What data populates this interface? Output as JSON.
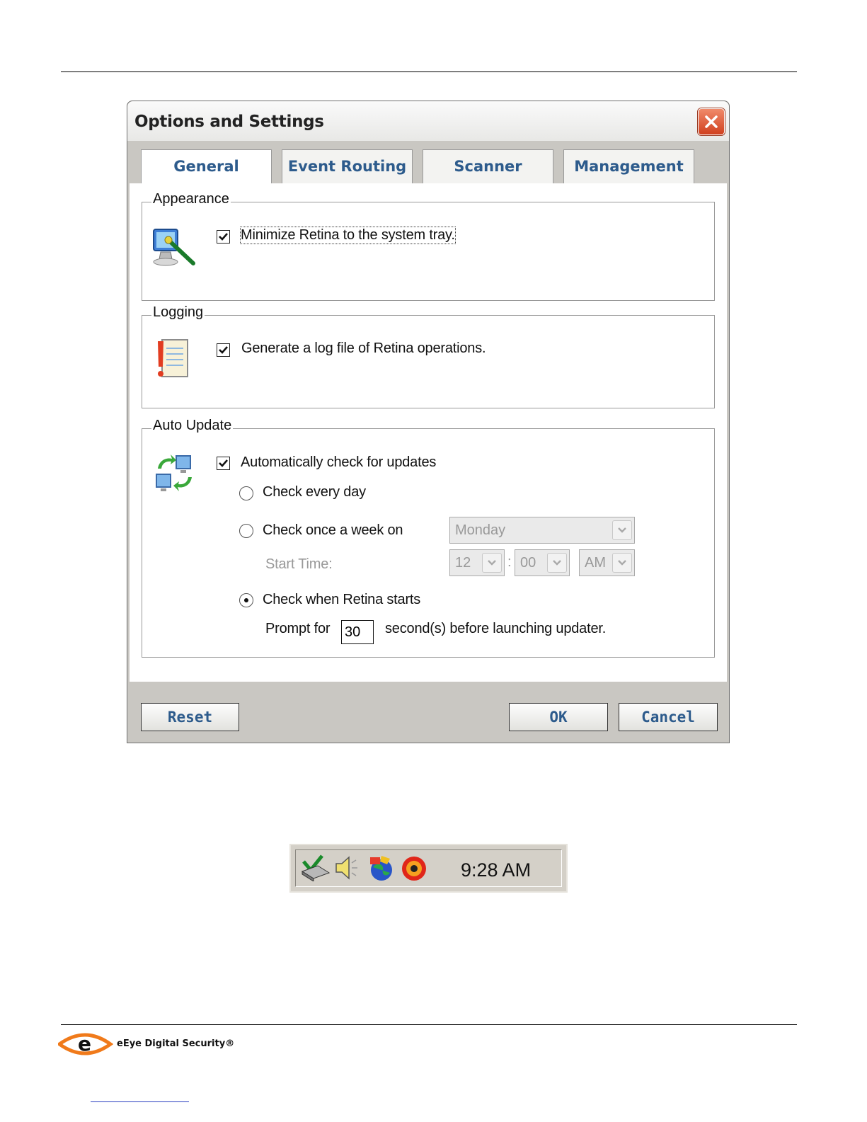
{
  "dialog": {
    "title": "Options and Settings",
    "tabs": [
      {
        "label": "General"
      },
      {
        "label": "Event Routing"
      },
      {
        "label": "Scanner"
      },
      {
        "label": "Management"
      }
    ],
    "appearance": {
      "legend": "Appearance",
      "minimize_label": "Minimize Retina to the system tray.",
      "minimize_checked": true
    },
    "logging": {
      "legend": "Logging",
      "log_label": "Generate a log file of Retina operations.",
      "log_checked": true
    },
    "auto_update": {
      "legend": "Auto Update",
      "auto_check_label": "Automatically check for updates",
      "auto_check_checked": true,
      "every_day_label": "Check every day",
      "once_week_label": "Check once a week on",
      "weekday_value": "Monday",
      "start_time_label": "Start Time:",
      "hour_value": "12",
      "time_separator": ":",
      "minute_value": "00",
      "ampm_value": "AM",
      "retina_starts_label": "Check when Retina starts",
      "selected_option": "retina_starts",
      "prompt_for_label": "Prompt for",
      "prompt_seconds": "30",
      "seconds_suffix": "second(s) before launching updater."
    },
    "buttons": {
      "reset": "Reset",
      "ok": "OK",
      "cancel": "Cancel"
    }
  },
  "tray": {
    "time": "9:28 AM",
    "icons": [
      "network-icon",
      "speaker-icon",
      "globe-icon",
      "retina-icon"
    ]
  },
  "footer": {
    "brand": "eEye Digital Security®"
  },
  "colors": {
    "tab_text": "#2d5b8c",
    "logo_orange": "#f07a1a"
  }
}
